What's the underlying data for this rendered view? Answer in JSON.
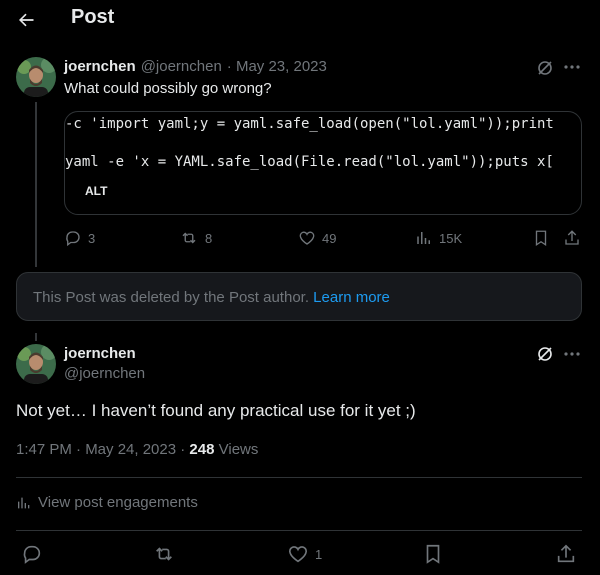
{
  "header": {
    "title": "Post",
    "back_icon": "arrow-left-icon"
  },
  "parent_post": {
    "display_name": "joernchen",
    "handle": "@joernchen",
    "date": "· May 23, 2023",
    "text": "What could possibly go wrong?",
    "code_lines": [
      "-c 'import yaml;y = yaml.safe_load(open(\"lol.yaml\"));print",
      "yaml -e 'x = YAML.safe_load(File.read(\"lol.yaml\"));puts x["
    ],
    "alt_label": "ALT",
    "actions": {
      "replies": "3",
      "reposts": "8",
      "likes": "49",
      "views": "15K"
    }
  },
  "deleted_notice": {
    "text": "This Post was deleted by the Post author.",
    "link": "Learn more"
  },
  "reply_post": {
    "display_name": "joernchen",
    "handle": "@joernchen",
    "text": "Not yet… I haven’t found any practical use for it yet ;)",
    "time": "1:47 PM · May 24, 2023 ·",
    "views_count": "248",
    "views_label": "Views",
    "engagements_label": "View post engagements",
    "actions": {
      "likes": "1"
    }
  },
  "colors": {
    "background": "#000000",
    "text": "#e7e9ea",
    "muted": "#71767b",
    "link": "#1d9bf0",
    "border": "#2f3336"
  }
}
